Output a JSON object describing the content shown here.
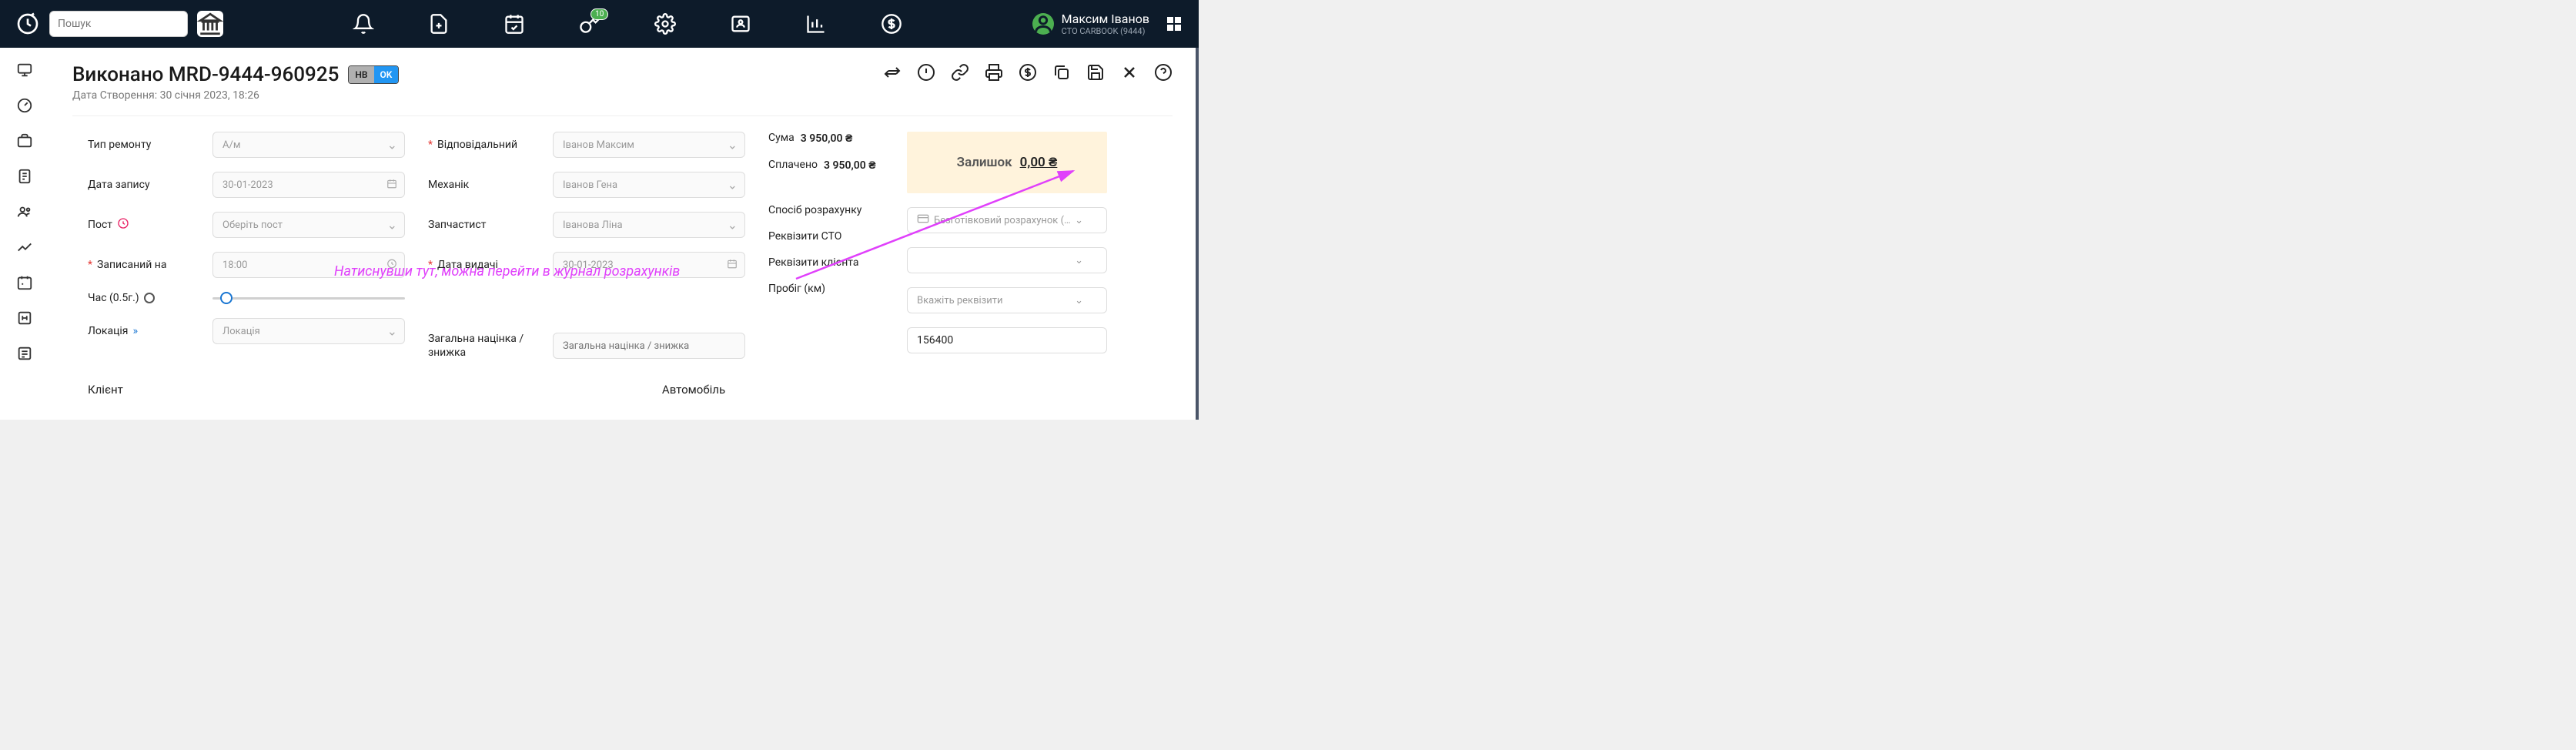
{
  "top": {
    "search_placeholder": "Пошук",
    "key_badge": "10",
    "user_name": "Максим Іванов",
    "user_sub": "СТО CARBOOK (9444)"
  },
  "page": {
    "title": "Виконано MRD-9444-960925",
    "pill_grey": "НВ",
    "pill_blue": "OK",
    "created_prefix": "Дата Створення:",
    "created_value": "30 січня 2023, 18:26"
  },
  "labels": {
    "repair_type": "Тип ремонту",
    "record_date": "Дата запису",
    "post": "Пост",
    "booked_for": "Записаний на",
    "duration": "Час (0.5г.)",
    "location": "Локація",
    "responsible": "Відповідальний",
    "mechanic": "Механік",
    "partsman": "Запчастист",
    "issue_date": "Дата видачі",
    "markup": "Загальна націнка / знижка",
    "sum": "Сума",
    "paid": "Сплачено",
    "pay_method": "Спосіб розрахунку",
    "sto_req": "Реквізити СТО",
    "client_req": "Реквізити клієнта",
    "mileage": "Пробіг (км)",
    "client": "Клієнт",
    "auto": "Автомобіль"
  },
  "values": {
    "repair_type": "А/м",
    "record_date": "30-01-2023",
    "post": "Оберіть пост",
    "booked_for": "18:00",
    "location": "Локація",
    "responsible": "Іванов Максим",
    "mechanic": "Іванов Гена",
    "partsman": "Іванова Ліна",
    "issue_date": "30-01-2023",
    "markup_ph": "Загальна націнка / знижка",
    "sum": "3 950,00 ₴",
    "paid": "3 950,00 ₴",
    "pay_method": "Безготівковий розрахунок (0.0...",
    "client_req": "Вкажіть реквізити",
    "mileage": "156400"
  },
  "balance": {
    "label": "Залишок",
    "value": "0,00 ₴"
  },
  "annotation": "Натиснувши тут, можна перейти в журнал розрахунків"
}
